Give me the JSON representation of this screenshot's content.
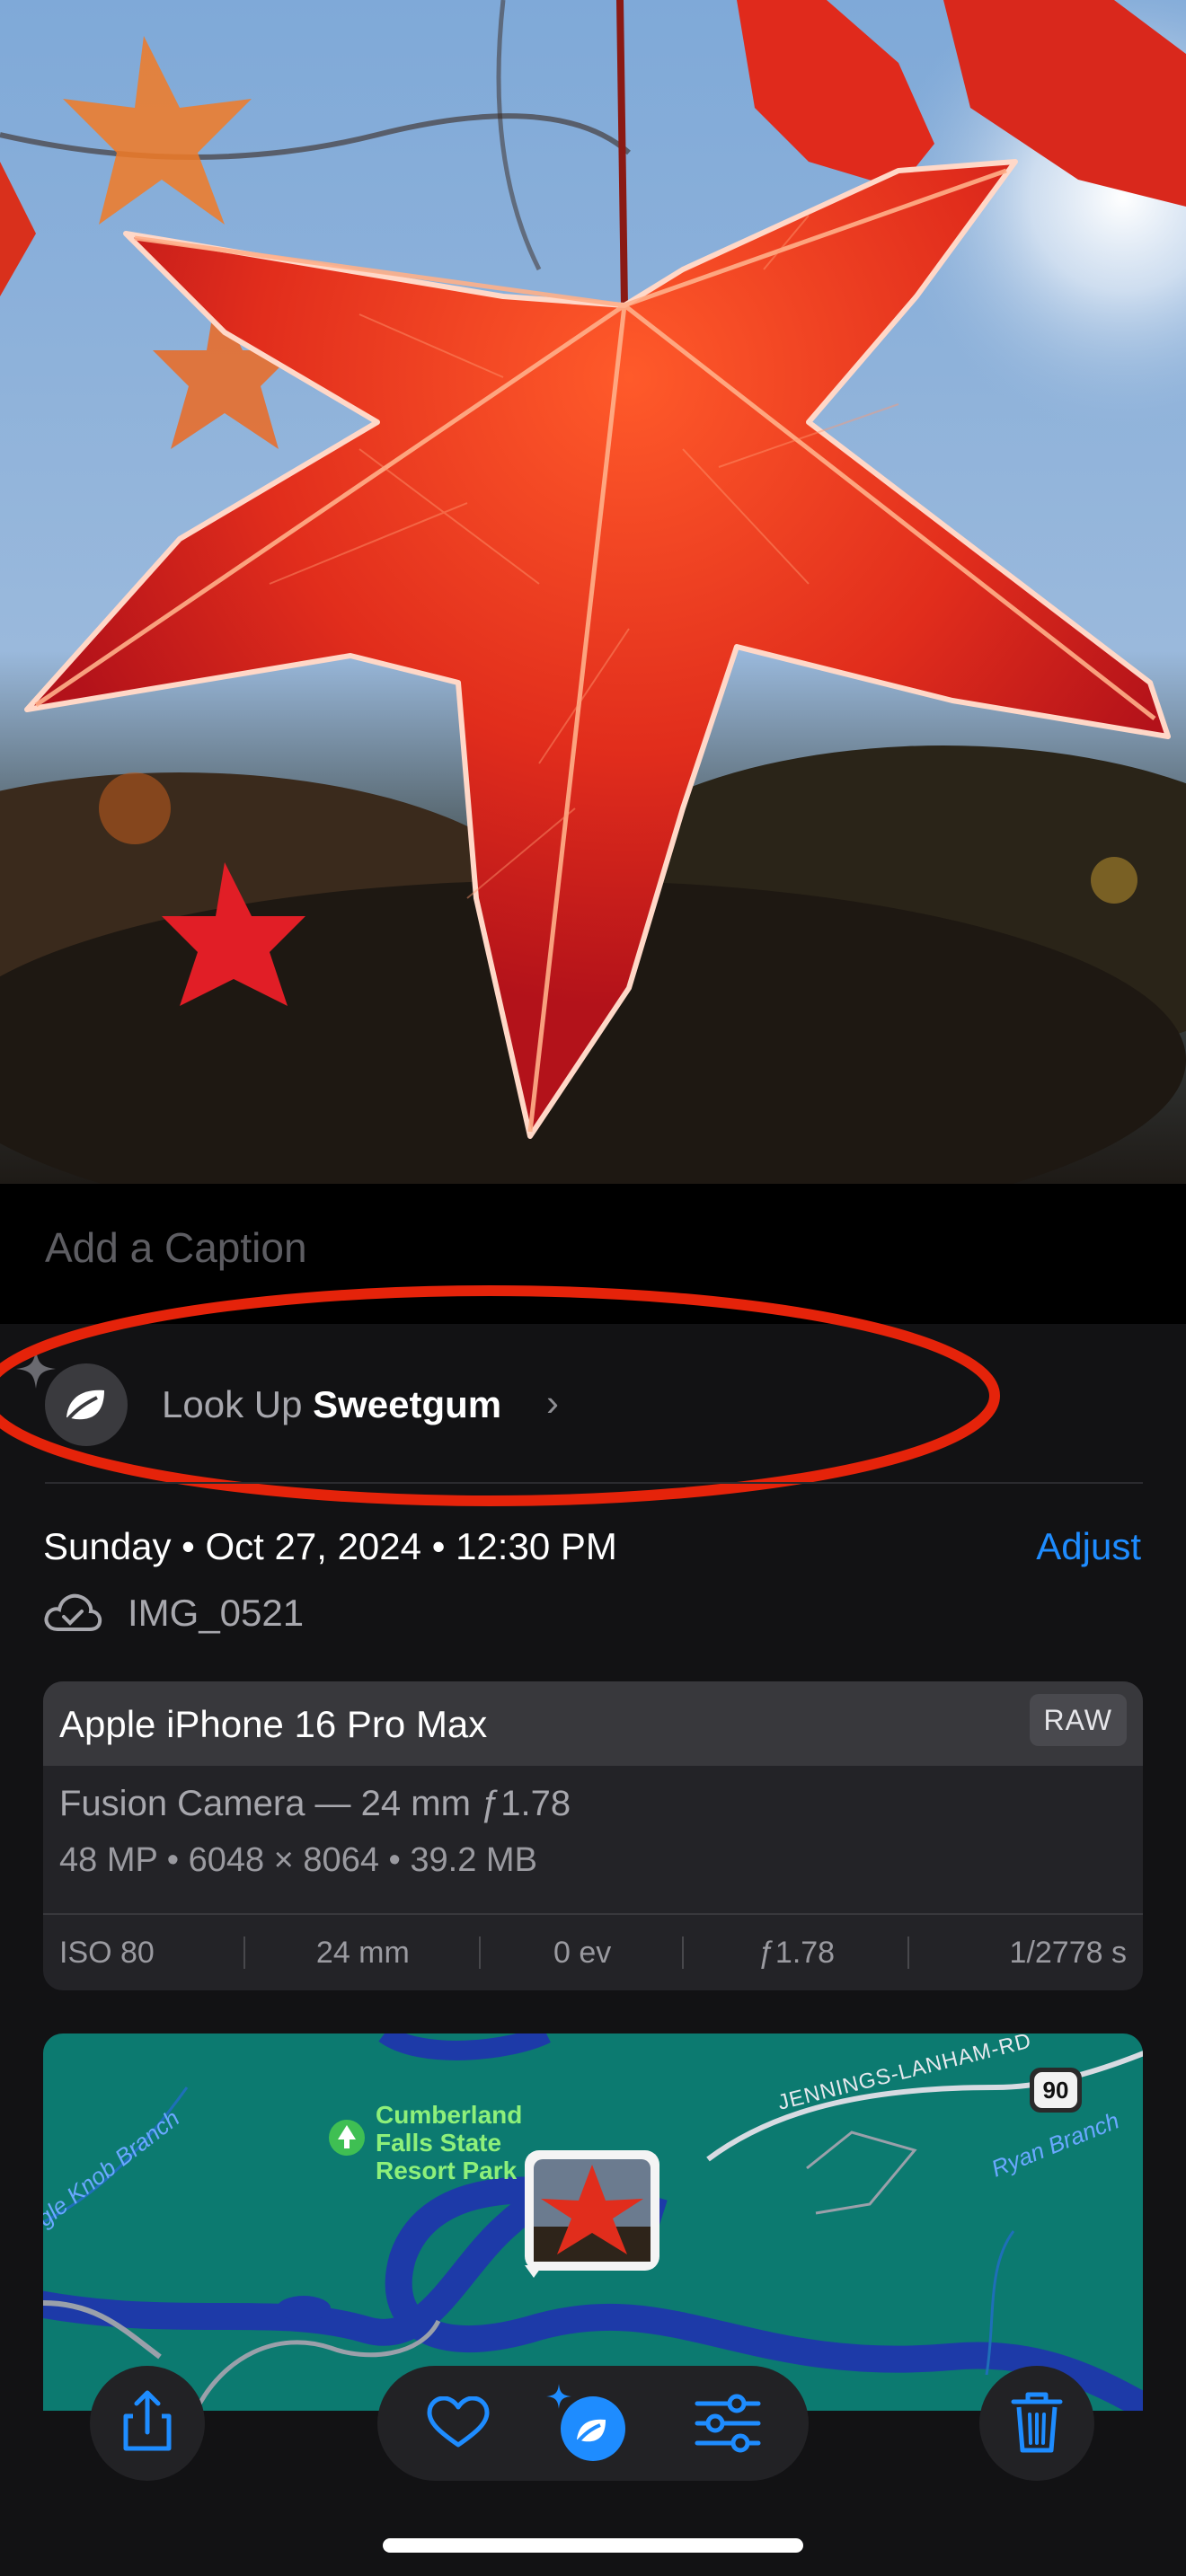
{
  "caption": {
    "placeholder": "Add a Caption"
  },
  "lookup": {
    "prefix": "Look Up",
    "subject": "Sweetgum",
    "icon": "leaf-icon"
  },
  "date": {
    "day": "Sunday",
    "date": "Oct 27, 2024",
    "time": "12:30 PM",
    "separator": "•"
  },
  "adjust_label": "Adjust",
  "file": {
    "name": "IMG_0521",
    "icon": "icloud-check-icon"
  },
  "camera": {
    "model": "Apple iPhone 16 Pro Max",
    "format_badge": "RAW",
    "lens": "Fusion Camera — 24 mm ƒ1.78",
    "megapixels": "48 MP",
    "dimensions": "6048 × 8064",
    "size": "39.2 MB",
    "exif": [
      "ISO 80",
      "24 mm",
      "0 ev",
      "ƒ1.78",
      "1/2778 s"
    ]
  },
  "map": {
    "park": [
      "Cumberland",
      "Falls State",
      "Resort Park"
    ],
    "road": "JENNINGS-LANHAM-RD",
    "route_shield": "90",
    "streams": [
      "Ryan Branch",
      "gle Knob Branch"
    ]
  },
  "toolbar": {
    "share": "share-icon",
    "favorite": "heart-icon",
    "visual_lookup": "visual-lookup-icon",
    "edit": "adjust-sliders-icon",
    "delete": "trash-icon"
  },
  "colors": {
    "accent": "#1e8cff",
    "annotation": "#e5230a",
    "sheet": "#121214",
    "map_water": "#0c7a70"
  }
}
